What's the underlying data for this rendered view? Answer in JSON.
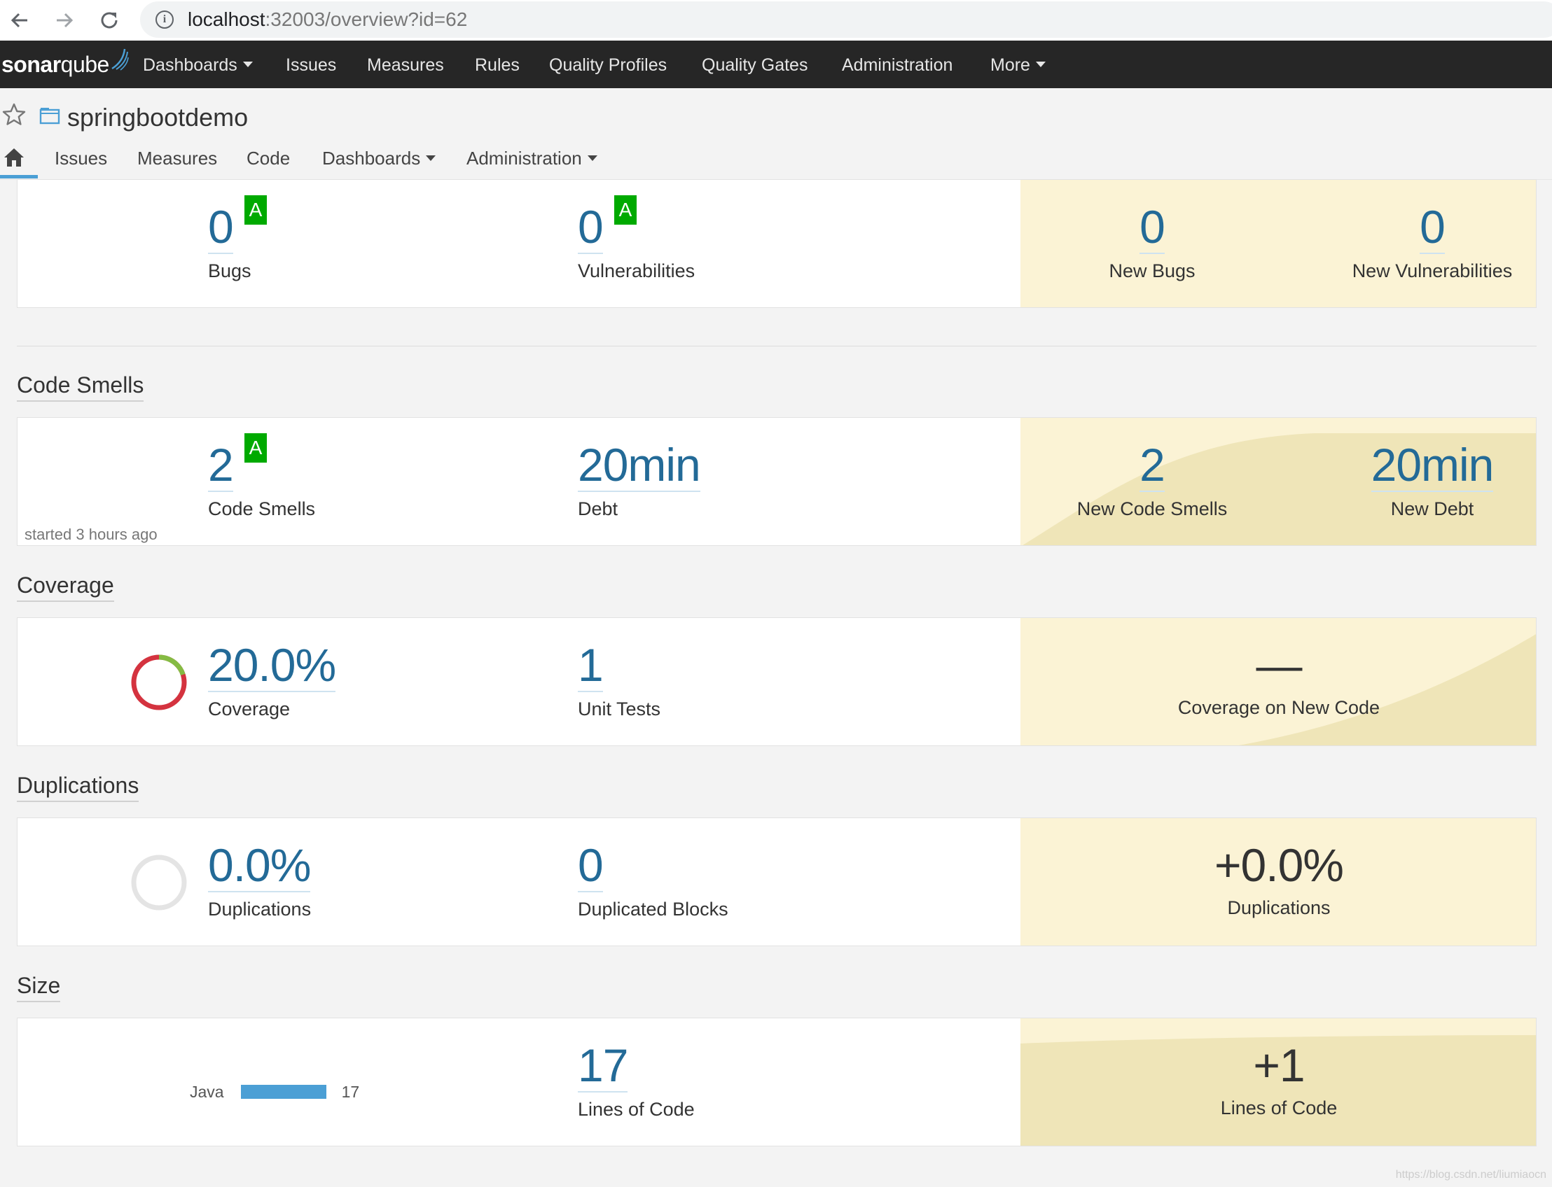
{
  "browser": {
    "url_host": "localhost",
    "url_rest": ":32003/overview?id=62"
  },
  "global_nav": {
    "logo_bold": "sonar",
    "logo_light": "qube",
    "items": [
      "Dashboards",
      "Issues",
      "Measures",
      "Rules",
      "Quality Profiles",
      "Quality Gates",
      "Administration",
      "More"
    ]
  },
  "component": {
    "name": "springbootdemo",
    "nav": [
      "Issues",
      "Measures",
      "Code",
      "Dashboards",
      "Administration"
    ]
  },
  "colors": {
    "accent": "#4b9fd5",
    "rating_a": "#00aa00",
    "leak_bg": "#fbf3d5",
    "coverage_red": "#d4333f",
    "coverage_green": "#85bb43"
  },
  "reliability": {
    "bugs": {
      "value": "0",
      "label": "Bugs",
      "rating": "A"
    },
    "vulnerabilities": {
      "value": "0",
      "label": "Vulnerabilities",
      "rating": "A"
    },
    "new_bugs": {
      "value": "0",
      "label": "New Bugs"
    },
    "new_vulnerabilities": {
      "value": "0",
      "label": "New Vulnerabilities"
    }
  },
  "code_smells": {
    "title": "Code Smells",
    "smells": {
      "value": "2",
      "label": "Code Smells",
      "rating": "A"
    },
    "debt": {
      "value": "20min",
      "label": "Debt"
    },
    "new_smells": {
      "value": "2",
      "label": "New Code Smells"
    },
    "new_debt": {
      "value": "20min",
      "label": "New Debt"
    },
    "started": "started 3 hours ago"
  },
  "coverage": {
    "title": "Coverage",
    "coverage": {
      "value": "20.0%",
      "label": "Coverage",
      "percent": 20.0
    },
    "unit_tests": {
      "value": "1",
      "label": "Unit Tests"
    },
    "new_coverage": {
      "value": "—",
      "label": "Coverage on New Code"
    }
  },
  "duplications": {
    "title": "Duplications",
    "duplications": {
      "value": "0.0%",
      "label": "Duplications",
      "percent": 0.0
    },
    "blocks": {
      "value": "0",
      "label": "Duplicated Blocks"
    },
    "new_duplications": {
      "value": "+0.0%",
      "label": "Duplications"
    }
  },
  "size": {
    "title": "Size",
    "language": {
      "name": "Java",
      "lines": "17"
    },
    "lines": {
      "value": "17",
      "label": "Lines of Code"
    },
    "new_lines": {
      "value": "+1",
      "label": "Lines of Code"
    }
  },
  "watermark": "https://blog.csdn.net/liumiaocn"
}
